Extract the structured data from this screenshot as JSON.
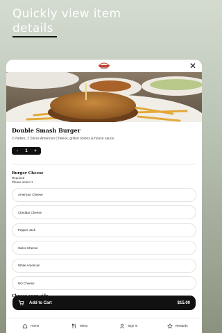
{
  "promo": {
    "title": "Quickly view item details"
  },
  "modal": {
    "close_symbol": "✕",
    "item": {
      "name": "Double Smash Burger",
      "description": "2 Patties, 2 Slices American Cheese, grilled onions & house sauce."
    },
    "quantity": {
      "minus": "-",
      "value": "1",
      "plus": "+"
    },
    "modifier_group": {
      "title": "Burger Cheese",
      "required": "Required",
      "instruction": "Please select 1",
      "options": [
        "American Cheese",
        "Cheddar Cheese",
        "Pepper Jack",
        "Swiss Cheese",
        "White American",
        "NO Cheese"
      ]
    },
    "next_group_title": "Choose your side"
  },
  "cart_button": {
    "label": "Add to Cart",
    "price": "$15.00"
  },
  "bottom_nav": {
    "items": [
      {
        "label": "Home",
        "icon": "home-icon"
      },
      {
        "label": "Menu",
        "icon": "utensils-icon"
      },
      {
        "label": "Sign In",
        "icon": "user-icon"
      },
      {
        "label": "Rewards",
        "icon": "star-icon"
      }
    ]
  },
  "colors": {
    "accent": "#111111",
    "background_top": "#d3dccf",
    "background_bottom": "#8a917f"
  }
}
